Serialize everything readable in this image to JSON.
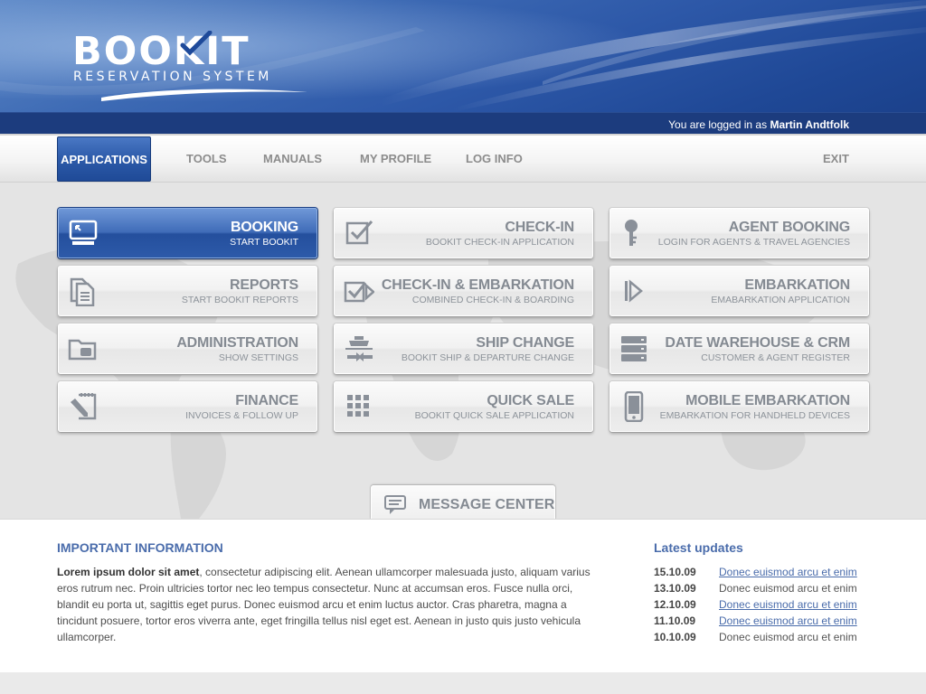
{
  "logo": {
    "title": "BOOKIT",
    "subtitle": "RESERVATION SYSTEM"
  },
  "login": {
    "prefix": "You are logged in as",
    "user": "Martin Andtfolk"
  },
  "nav": [
    {
      "label": "APPLICATIONS",
      "active": true
    },
    {
      "label": "TOOLS"
    },
    {
      "label": "MANUALS"
    },
    {
      "label": "MY PROFILE"
    },
    {
      "label": "LOG INFO"
    },
    {
      "label": "EXIT"
    }
  ],
  "tiles": [
    {
      "title": "BOOKING",
      "subtitle": "START BOOKIT",
      "icon": "monitor-icon",
      "active": true
    },
    {
      "title": "CHECK-IN",
      "subtitle": "BOOKIT CHECK-IN APPLICATION",
      "icon": "checkbox-icon"
    },
    {
      "title": "AGENT BOOKING",
      "subtitle": "LOGIN FOR AGENTS & TRAVEL AGENCIES",
      "icon": "key-icon"
    },
    {
      "title": "REPORTS",
      "subtitle": "START BOOKIT REPORTS",
      "icon": "documents-icon"
    },
    {
      "title": "CHECK-IN & EMBARKATION",
      "subtitle": "COMBINED CHECK-IN & BOARDING",
      "icon": "checkbox-arrow-icon"
    },
    {
      "title": "EMBARKATION",
      "subtitle": "EMABARKATION APPLICATION",
      "icon": "play-arrow-icon"
    },
    {
      "title": "ADMINISTRATION",
      "subtitle": "SHOW SETTINGS",
      "icon": "folder-icon"
    },
    {
      "title": "SHIP CHANGE",
      "subtitle": "BOOKIT SHIP & DEPARTURE CHANGE",
      "icon": "ship-swap-icon"
    },
    {
      "title": "DATE WAREHOUSE & CRM",
      "subtitle": "CUSTOMER & AGENT REGISTER",
      "icon": "server-icon"
    },
    {
      "title": "FINANCE",
      "subtitle": "INVOICES & FOLLOW UP",
      "icon": "invoice-pen-icon"
    },
    {
      "title": "QUICK SALE",
      "subtitle": "BOOKIT QUICK SALE APPLICATION",
      "icon": "grid-icon"
    },
    {
      "title": "MOBILE EMBARKATION",
      "subtitle": "EMBARKATION FOR HANDHELD DEVICES",
      "icon": "mobile-icon"
    }
  ],
  "message_center": {
    "label": "MESSAGE CENTER",
    "icon": "chat-bubble-icon"
  },
  "info": {
    "heading": "IMPORTANT INFORMATION",
    "lead": "Lorem ipsum dolor sit amet",
    "body": ", consectetur adipiscing elit. Aenean ullamcorper malesuada justo, aliquam varius eros rutrum nec. Proin ultricies tortor nec leo tempus consectetur. Nunc at accumsan eros. Fusce nulla orci, blandit eu porta ut, sagittis eget purus. Donec euismod arcu et enim luctus auctor. Cras pharetra, magna a tincidunt posuere, tortor eros viverra ante, eget fringilla tellus nisl eget est. Aenean in justo quis justo vehicula ullamcorper."
  },
  "updates": {
    "heading": "Latest updates",
    "items": [
      {
        "date": "15.10.09",
        "text": "Donec euismod arcu et enim",
        "link": true
      },
      {
        "date": "13.10.09",
        "text": "Donec euismod arcu et enim",
        "link": false
      },
      {
        "date": "12.10.09",
        "text": "Donec euismod arcu et enim",
        "link": true
      },
      {
        "date": "11.10.09",
        "text": "Donec euismod arcu et enim",
        "link": true
      },
      {
        "date": "10.10.09",
        "text": "Donec euismod arcu et enim",
        "link": false
      }
    ]
  },
  "colors": {
    "brand_blue": "#2c5aa9",
    "heading_blue": "#4a6cab",
    "tile_text": "#848a92"
  }
}
